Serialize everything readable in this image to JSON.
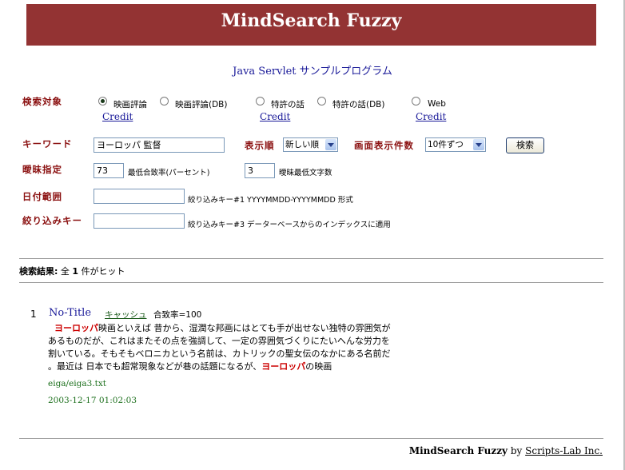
{
  "banner": {
    "title": "MindSearch Fuzzy"
  },
  "subtitle": "Java Servlet サンプルプログラム",
  "form": {
    "target_label": "検索対象",
    "targets": [
      {
        "label": "映画評論",
        "selected": true
      },
      {
        "label": "映画評論(DB)",
        "selected": false
      },
      {
        "label": "特許の話",
        "selected": false
      },
      {
        "label": "特許の話(DB)",
        "selected": false
      },
      {
        "label": "Web",
        "selected": false
      }
    ],
    "credit_label": "Credit",
    "keyword_label": "キーワード",
    "keyword_value": "ヨーロッパ 監督",
    "display_order_label": "表示順",
    "display_order_value": "新しい順",
    "per_page_label": "画面表示件数",
    "per_page_value": "10件ずつ",
    "search_button": "検索",
    "fuzzy_label": "曖昧指定",
    "min_match_value": "73",
    "min_match_note": "最低合致率(パーセント)",
    "fuzzy_min_chars_value": "3",
    "fuzzy_min_chars_note": "曖昧最低文字数",
    "date_range_label": "日付範囲",
    "date_range_value": "",
    "date_range_note": "絞り込みキー#1 YYYYMMDD-YYYYMMDD 形式",
    "filter_key_label": "絞り込みキー",
    "filter_key_value": "",
    "filter_key_note": "絞り込みキー#3 データーベースからのインデックスに適用"
  },
  "results": {
    "summary_prefix": "検索結果:",
    "summary_all": "全",
    "summary_count": "1",
    "summary_suffix": "件がヒット",
    "items": [
      {
        "number": "1",
        "title": "No-Title",
        "cache_label": "キャッシュ",
        "match": "合致率=100",
        "snippet": {
          "l1_hl": "ヨーロッパ",
          "l1": "映画といえば 昔から、湿潤な邦画にはとても手が出せない独特の雰囲気が",
          "l2": "あるものだが、これはまたその点を強調して、一定の雰囲気づくりにたいへんな労力を",
          "l3": "割いている。そもそもベロニカという名前は、カトリックの聖女伝のなかにある名前だ",
          "l4": "。最近は 日本でも超常現象などが巷の話題になるが、",
          "l4_hl": "ヨーロッパ",
          "l4_end": "の映画"
        },
        "path": "eiga/eiga3.txt",
        "timestamp": "2003-12-17 01:02:03"
      }
    ]
  },
  "footer": {
    "product": "MindSearch Fuzzy",
    "by": "by",
    "company": "Scripts-Lab Inc."
  },
  "colors": {
    "banner": "#933333",
    "label": "#8b1111",
    "link": "#1a1a99",
    "highlight": "#cc0000",
    "path": "#1a6e1a"
  }
}
